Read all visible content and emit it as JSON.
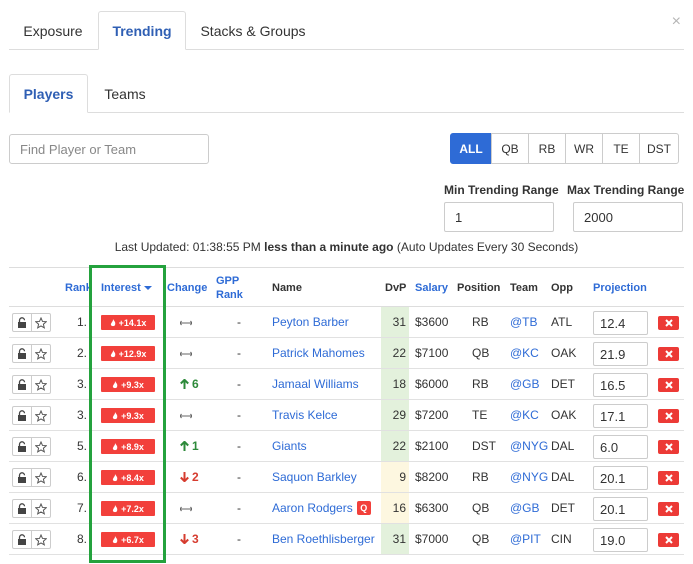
{
  "top_tabs": [
    {
      "label": "Exposure",
      "active": false
    },
    {
      "label": "Trending",
      "active": true
    },
    {
      "label": "Stacks & Groups",
      "active": false
    }
  ],
  "close_glyph": "×",
  "sub_tabs": [
    {
      "label": "Players",
      "active": true
    },
    {
      "label": "Teams",
      "active": false
    }
  ],
  "search": {
    "placeholder": "Find Player or Team",
    "value": ""
  },
  "positions": [
    {
      "label": "ALL",
      "active": true
    },
    {
      "label": "QB",
      "active": false
    },
    {
      "label": "RB",
      "active": false
    },
    {
      "label": "WR",
      "active": false
    },
    {
      "label": "TE",
      "active": false
    },
    {
      "label": "DST",
      "active": false
    }
  ],
  "min_range": {
    "label": "Min Trending Range",
    "value": "1"
  },
  "max_range": {
    "label": "Max Trending Range",
    "value": "2000"
  },
  "last_updated": {
    "prefix": "Last Updated: 01:38:55 PM",
    "relative": "less than a minute ago",
    "suffix": "(Auto Updates Every 30 Seconds)"
  },
  "columns": {
    "rank": "Rank",
    "interest": "Interest",
    "change": "Change",
    "gpp_rank_1": "GPP",
    "gpp_rank_2": "Rank",
    "name": "Name",
    "dvp": "DvP",
    "salary": "Salary",
    "position": "Position",
    "team": "Team",
    "opp": "Opp",
    "projection": "Projection"
  },
  "colors": {
    "accent": "#2e6bd6",
    "badge_red": "#f2403b",
    "up_green": "#2d8a3a",
    "down_red": "#d63c2f",
    "highlight_green": "#24a23d",
    "dvp_green": "#e3f1dc",
    "dvp_yellow": "#fdf7e0"
  },
  "rows": [
    {
      "rank": "1.",
      "interest": "+14.1x",
      "change_dir": "flat",
      "change": "",
      "gpp": "-",
      "name": "Peyton Barber",
      "tag": "",
      "dvp": "31",
      "dvp_tone": "green",
      "salary": "$3600",
      "position": "RB",
      "team": "@TB",
      "opp": "ATL",
      "projection": "12.4"
    },
    {
      "rank": "2.",
      "interest": "+12.9x",
      "change_dir": "flat",
      "change": "",
      "gpp": "-",
      "name": "Patrick Mahomes",
      "tag": "",
      "dvp": "22",
      "dvp_tone": "green",
      "salary": "$7100",
      "position": "QB",
      "team": "@KC",
      "opp": "OAK",
      "projection": "21.9"
    },
    {
      "rank": "3.",
      "interest": "+9.3x",
      "change_dir": "up",
      "change": "6",
      "gpp": "-",
      "name": "Jamaal Williams",
      "tag": "",
      "dvp": "18",
      "dvp_tone": "green",
      "salary": "$6000",
      "position": "RB",
      "team": "@GB",
      "opp": "DET",
      "projection": "16.5"
    },
    {
      "rank": "3.",
      "interest": "+9.3x",
      "change_dir": "flat",
      "change": "",
      "gpp": "-",
      "name": "Travis Kelce",
      "tag": "",
      "dvp": "29",
      "dvp_tone": "green",
      "salary": "$7200",
      "position": "TE",
      "team": "@KC",
      "opp": "OAK",
      "projection": "17.1"
    },
    {
      "rank": "5.",
      "interest": "+8.9x",
      "change_dir": "up",
      "change": "1",
      "gpp": "-",
      "name": "Giants",
      "tag": "",
      "dvp": "22",
      "dvp_tone": "green",
      "salary": "$2100",
      "position": "DST",
      "team": "@NYG",
      "opp": "DAL",
      "projection": "6.0"
    },
    {
      "rank": "6.",
      "interest": "+8.4x",
      "change_dir": "down",
      "change": "2",
      "gpp": "-",
      "name": "Saquon Barkley",
      "tag": "",
      "dvp": "9",
      "dvp_tone": "yellow",
      "salary": "$8200",
      "position": "RB",
      "team": "@NYG",
      "opp": "DAL",
      "projection": "20.1"
    },
    {
      "rank": "7.",
      "interest": "+7.2x",
      "change_dir": "flat",
      "change": "",
      "gpp": "-",
      "name": "Aaron Rodgers",
      "tag": "Q",
      "dvp": "16",
      "dvp_tone": "yellow",
      "salary": "$6300",
      "position": "QB",
      "team": "@GB",
      "opp": "DET",
      "projection": "20.1"
    },
    {
      "rank": "8.",
      "interest": "+6.7x",
      "change_dir": "down",
      "change": "3",
      "gpp": "-",
      "name": "Ben Roethlisberger",
      "tag": "",
      "dvp": "31",
      "dvp_tone": "green",
      "salary": "$7000",
      "position": "QB",
      "team": "@PIT",
      "opp": "CIN",
      "projection": "19.0"
    }
  ]
}
